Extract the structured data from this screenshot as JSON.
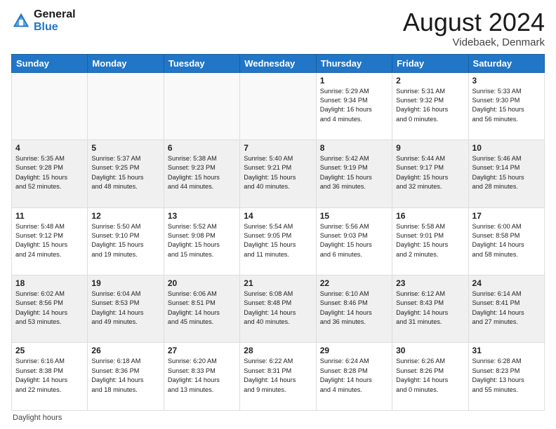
{
  "header": {
    "logo_line1": "General",
    "logo_line2": "Blue",
    "month_year": "August 2024",
    "location": "Videbaek, Denmark"
  },
  "footer": {
    "note": "Daylight hours"
  },
  "days_of_week": [
    "Sunday",
    "Monday",
    "Tuesday",
    "Wednesday",
    "Thursday",
    "Friday",
    "Saturday"
  ],
  "weeks": [
    [
      {
        "num": "",
        "info": "",
        "empty": true
      },
      {
        "num": "",
        "info": "",
        "empty": true
      },
      {
        "num": "",
        "info": "",
        "empty": true
      },
      {
        "num": "",
        "info": "",
        "empty": true
      },
      {
        "num": "1",
        "info": "Sunrise: 5:29 AM\nSunset: 9:34 PM\nDaylight: 16 hours\nand 4 minutes.",
        "empty": false
      },
      {
        "num": "2",
        "info": "Sunrise: 5:31 AM\nSunset: 9:32 PM\nDaylight: 16 hours\nand 0 minutes.",
        "empty": false
      },
      {
        "num": "3",
        "info": "Sunrise: 5:33 AM\nSunset: 9:30 PM\nDaylight: 15 hours\nand 56 minutes.",
        "empty": false
      }
    ],
    [
      {
        "num": "4",
        "info": "Sunrise: 5:35 AM\nSunset: 9:28 PM\nDaylight: 15 hours\nand 52 minutes.",
        "empty": false
      },
      {
        "num": "5",
        "info": "Sunrise: 5:37 AM\nSunset: 9:25 PM\nDaylight: 15 hours\nand 48 minutes.",
        "empty": false
      },
      {
        "num": "6",
        "info": "Sunrise: 5:38 AM\nSunset: 9:23 PM\nDaylight: 15 hours\nand 44 minutes.",
        "empty": false
      },
      {
        "num": "7",
        "info": "Sunrise: 5:40 AM\nSunset: 9:21 PM\nDaylight: 15 hours\nand 40 minutes.",
        "empty": false
      },
      {
        "num": "8",
        "info": "Sunrise: 5:42 AM\nSunset: 9:19 PM\nDaylight: 15 hours\nand 36 minutes.",
        "empty": false
      },
      {
        "num": "9",
        "info": "Sunrise: 5:44 AM\nSunset: 9:17 PM\nDaylight: 15 hours\nand 32 minutes.",
        "empty": false
      },
      {
        "num": "10",
        "info": "Sunrise: 5:46 AM\nSunset: 9:14 PM\nDaylight: 15 hours\nand 28 minutes.",
        "empty": false
      }
    ],
    [
      {
        "num": "11",
        "info": "Sunrise: 5:48 AM\nSunset: 9:12 PM\nDaylight: 15 hours\nand 24 minutes.",
        "empty": false
      },
      {
        "num": "12",
        "info": "Sunrise: 5:50 AM\nSunset: 9:10 PM\nDaylight: 15 hours\nand 19 minutes.",
        "empty": false
      },
      {
        "num": "13",
        "info": "Sunrise: 5:52 AM\nSunset: 9:08 PM\nDaylight: 15 hours\nand 15 minutes.",
        "empty": false
      },
      {
        "num": "14",
        "info": "Sunrise: 5:54 AM\nSunset: 9:05 PM\nDaylight: 15 hours\nand 11 minutes.",
        "empty": false
      },
      {
        "num": "15",
        "info": "Sunrise: 5:56 AM\nSunset: 9:03 PM\nDaylight: 15 hours\nand 6 minutes.",
        "empty": false
      },
      {
        "num": "16",
        "info": "Sunrise: 5:58 AM\nSunset: 9:01 PM\nDaylight: 15 hours\nand 2 minutes.",
        "empty": false
      },
      {
        "num": "17",
        "info": "Sunrise: 6:00 AM\nSunset: 8:58 PM\nDaylight: 14 hours\nand 58 minutes.",
        "empty": false
      }
    ],
    [
      {
        "num": "18",
        "info": "Sunrise: 6:02 AM\nSunset: 8:56 PM\nDaylight: 14 hours\nand 53 minutes.",
        "empty": false
      },
      {
        "num": "19",
        "info": "Sunrise: 6:04 AM\nSunset: 8:53 PM\nDaylight: 14 hours\nand 49 minutes.",
        "empty": false
      },
      {
        "num": "20",
        "info": "Sunrise: 6:06 AM\nSunset: 8:51 PM\nDaylight: 14 hours\nand 45 minutes.",
        "empty": false
      },
      {
        "num": "21",
        "info": "Sunrise: 6:08 AM\nSunset: 8:48 PM\nDaylight: 14 hours\nand 40 minutes.",
        "empty": false
      },
      {
        "num": "22",
        "info": "Sunrise: 6:10 AM\nSunset: 8:46 PM\nDaylight: 14 hours\nand 36 minutes.",
        "empty": false
      },
      {
        "num": "23",
        "info": "Sunrise: 6:12 AM\nSunset: 8:43 PM\nDaylight: 14 hours\nand 31 minutes.",
        "empty": false
      },
      {
        "num": "24",
        "info": "Sunrise: 6:14 AM\nSunset: 8:41 PM\nDaylight: 14 hours\nand 27 minutes.",
        "empty": false
      }
    ],
    [
      {
        "num": "25",
        "info": "Sunrise: 6:16 AM\nSunset: 8:38 PM\nDaylight: 14 hours\nand 22 minutes.",
        "empty": false
      },
      {
        "num": "26",
        "info": "Sunrise: 6:18 AM\nSunset: 8:36 PM\nDaylight: 14 hours\nand 18 minutes.",
        "empty": false
      },
      {
        "num": "27",
        "info": "Sunrise: 6:20 AM\nSunset: 8:33 PM\nDaylight: 14 hours\nand 13 minutes.",
        "empty": false
      },
      {
        "num": "28",
        "info": "Sunrise: 6:22 AM\nSunset: 8:31 PM\nDaylight: 14 hours\nand 9 minutes.",
        "empty": false
      },
      {
        "num": "29",
        "info": "Sunrise: 6:24 AM\nSunset: 8:28 PM\nDaylight: 14 hours\nand 4 minutes.",
        "empty": false
      },
      {
        "num": "30",
        "info": "Sunrise: 6:26 AM\nSunset: 8:26 PM\nDaylight: 14 hours\nand 0 minutes.",
        "empty": false
      },
      {
        "num": "31",
        "info": "Sunrise: 6:28 AM\nSunset: 8:23 PM\nDaylight: 13 hours\nand 55 minutes.",
        "empty": false
      }
    ]
  ]
}
